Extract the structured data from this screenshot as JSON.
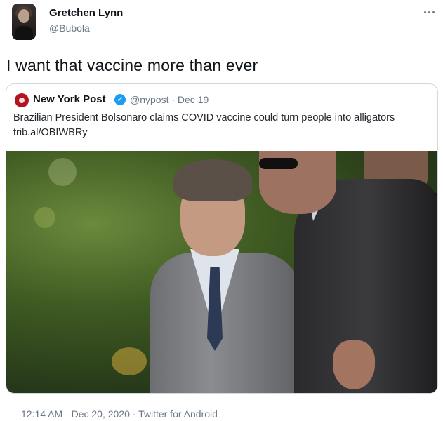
{
  "author": {
    "name": "Gretchen Lynn",
    "handle": "@Bubola"
  },
  "tweet": {
    "text": "I want that vaccine more than ever"
  },
  "quoted": {
    "name": "New York Post",
    "meta": "@nypost · Dec 19",
    "text": "Brazilian President Bolsonaro claims COVID vaccine could turn people into alligators trib.al/OBIWBRy",
    "verified_glyph": "✓",
    "photo_icon": "news-photo"
  },
  "footer": {
    "timestamp": "12:14 AM · Dec 20, 2020 · Twitter for Android"
  },
  "colors": {
    "verified": "#1d9bf0",
    "muted": "#6b7885",
    "nypost_red": "#b3121f"
  }
}
